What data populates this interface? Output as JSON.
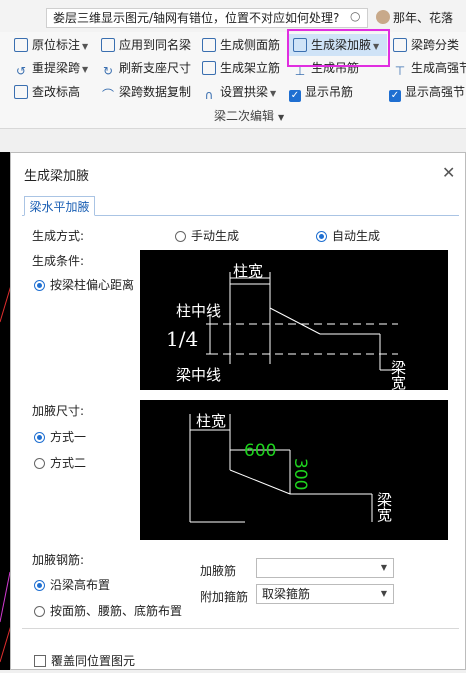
{
  "search": {
    "query": "娄层三维显示图元/轴网有错位，位置不对应如何处理?"
  },
  "user": {
    "name": "那年、花落"
  },
  "ribbon": {
    "row1": [
      "原位标注",
      "应用到同名梁",
      "生成侧面筋",
      "生成梁加腋",
      "梁跨分类"
    ],
    "row2": [
      "重提梁跨",
      "刷新支座尺寸",
      "生成架立筋",
      "生成吊筋",
      "生成高强节"
    ],
    "row3": [
      "查改标高",
      "梁跨数据复制",
      "设置拱梁",
      "显示吊筋",
      "显示高强节"
    ],
    "group": "梁二次编辑"
  },
  "dialog": {
    "title": "生成梁加腋",
    "tab": "梁水平加腋",
    "gen_method_label": "生成方式:",
    "manual": "手动生成",
    "auto": "自动生成",
    "condition_label": "生成条件:",
    "condition_option": "按梁柱偏心距离",
    "diagram1": {
      "col_width": "柱宽",
      "col_center": "柱中线",
      "fraction": "1/4",
      "beam_center": "梁中线",
      "beam_width": "梁宽"
    },
    "size_label": "加腋尺寸:",
    "method1": "方式一",
    "method2": "方式二",
    "diagram2": {
      "col_width": "柱宽",
      "dim1": "600",
      "dim2": "300",
      "beam_width": "梁宽"
    },
    "rebar_label": "加腋钢筋:",
    "rebar_opt1": "沿梁高布置",
    "rebar_opt2": "按面筋、腰筋、底筋布置",
    "haunch_bar_label": "加腋筋",
    "haunch_bar_value": "",
    "stirrup_label": "附加箍筋",
    "stirrup_value": "取梁箍筋",
    "cover_label": "覆盖同位置图元"
  }
}
